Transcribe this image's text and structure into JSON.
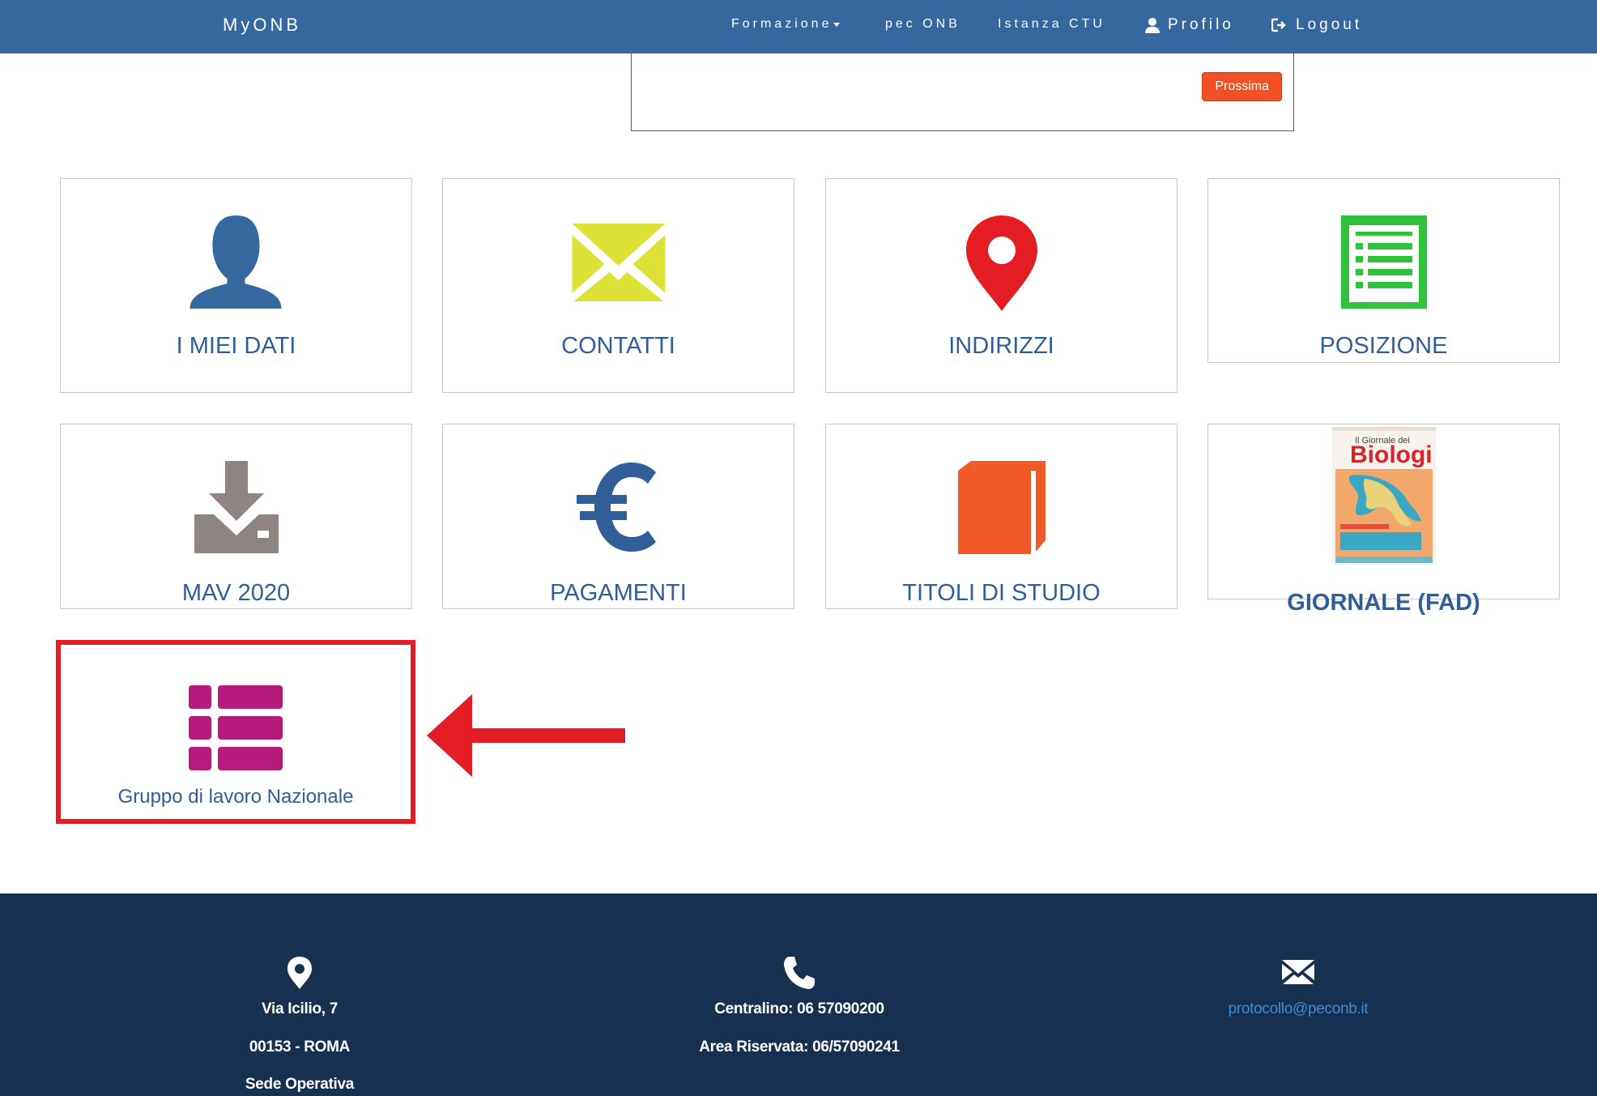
{
  "navbar": {
    "brand": "MyONB",
    "items": [
      {
        "label": "Formazione"
      },
      {
        "label": "pec ONB"
      },
      {
        "label": "Istanza CTU"
      },
      {
        "label": "Profilo"
      },
      {
        "label": "Logout"
      }
    ]
  },
  "notice": {
    "next_button": "Prossima"
  },
  "tiles": [
    {
      "label": "I MIEI DATI",
      "icon": "user-icon",
      "color": "#35689f"
    },
    {
      "label": "CONTATTI",
      "icon": "envelope-icon",
      "color": "#dde236"
    },
    {
      "label": "INDIRIZZI",
      "icon": "map-marker-icon",
      "color": "#e41c24"
    },
    {
      "label": "POSIZIONE",
      "icon": "list-document-icon",
      "color": "#2ec33a"
    },
    {
      "label": "MAV 2020",
      "icon": "download-icon",
      "color": "#8e8482"
    },
    {
      "label": "PAGAMENTI",
      "icon": "euro-icon",
      "color": "#2f5e98"
    },
    {
      "label": "TITOLI DI STUDIO",
      "icon": "book-icon",
      "color": "#f05a28"
    },
    {
      "label": "GIORNALE (FAD)",
      "icon": "magazine-cover-image",
      "cover_title_small": "Il Giornale dei",
      "cover_title": "Biologi"
    },
    {
      "label": "Gruppo di lavoro Nazionale",
      "icon": "th-list-icon",
      "color": "#b51b7a"
    }
  ],
  "footer": {
    "address": {
      "line1": "Via Icilio, 7",
      "line2": "00153 - ROMA",
      "line3": "Sede Operativa"
    },
    "phone": {
      "line1": "Centralino: 06 57090200",
      "line2": "Area Riservata: 06/57090241"
    },
    "email": {
      "address": "protocollo@peconb.it"
    }
  },
  "colors": {
    "navbar": "#35689f",
    "footer": "#18304f",
    "highlight": "#e41c24",
    "tile_text": "#2f5e98"
  }
}
